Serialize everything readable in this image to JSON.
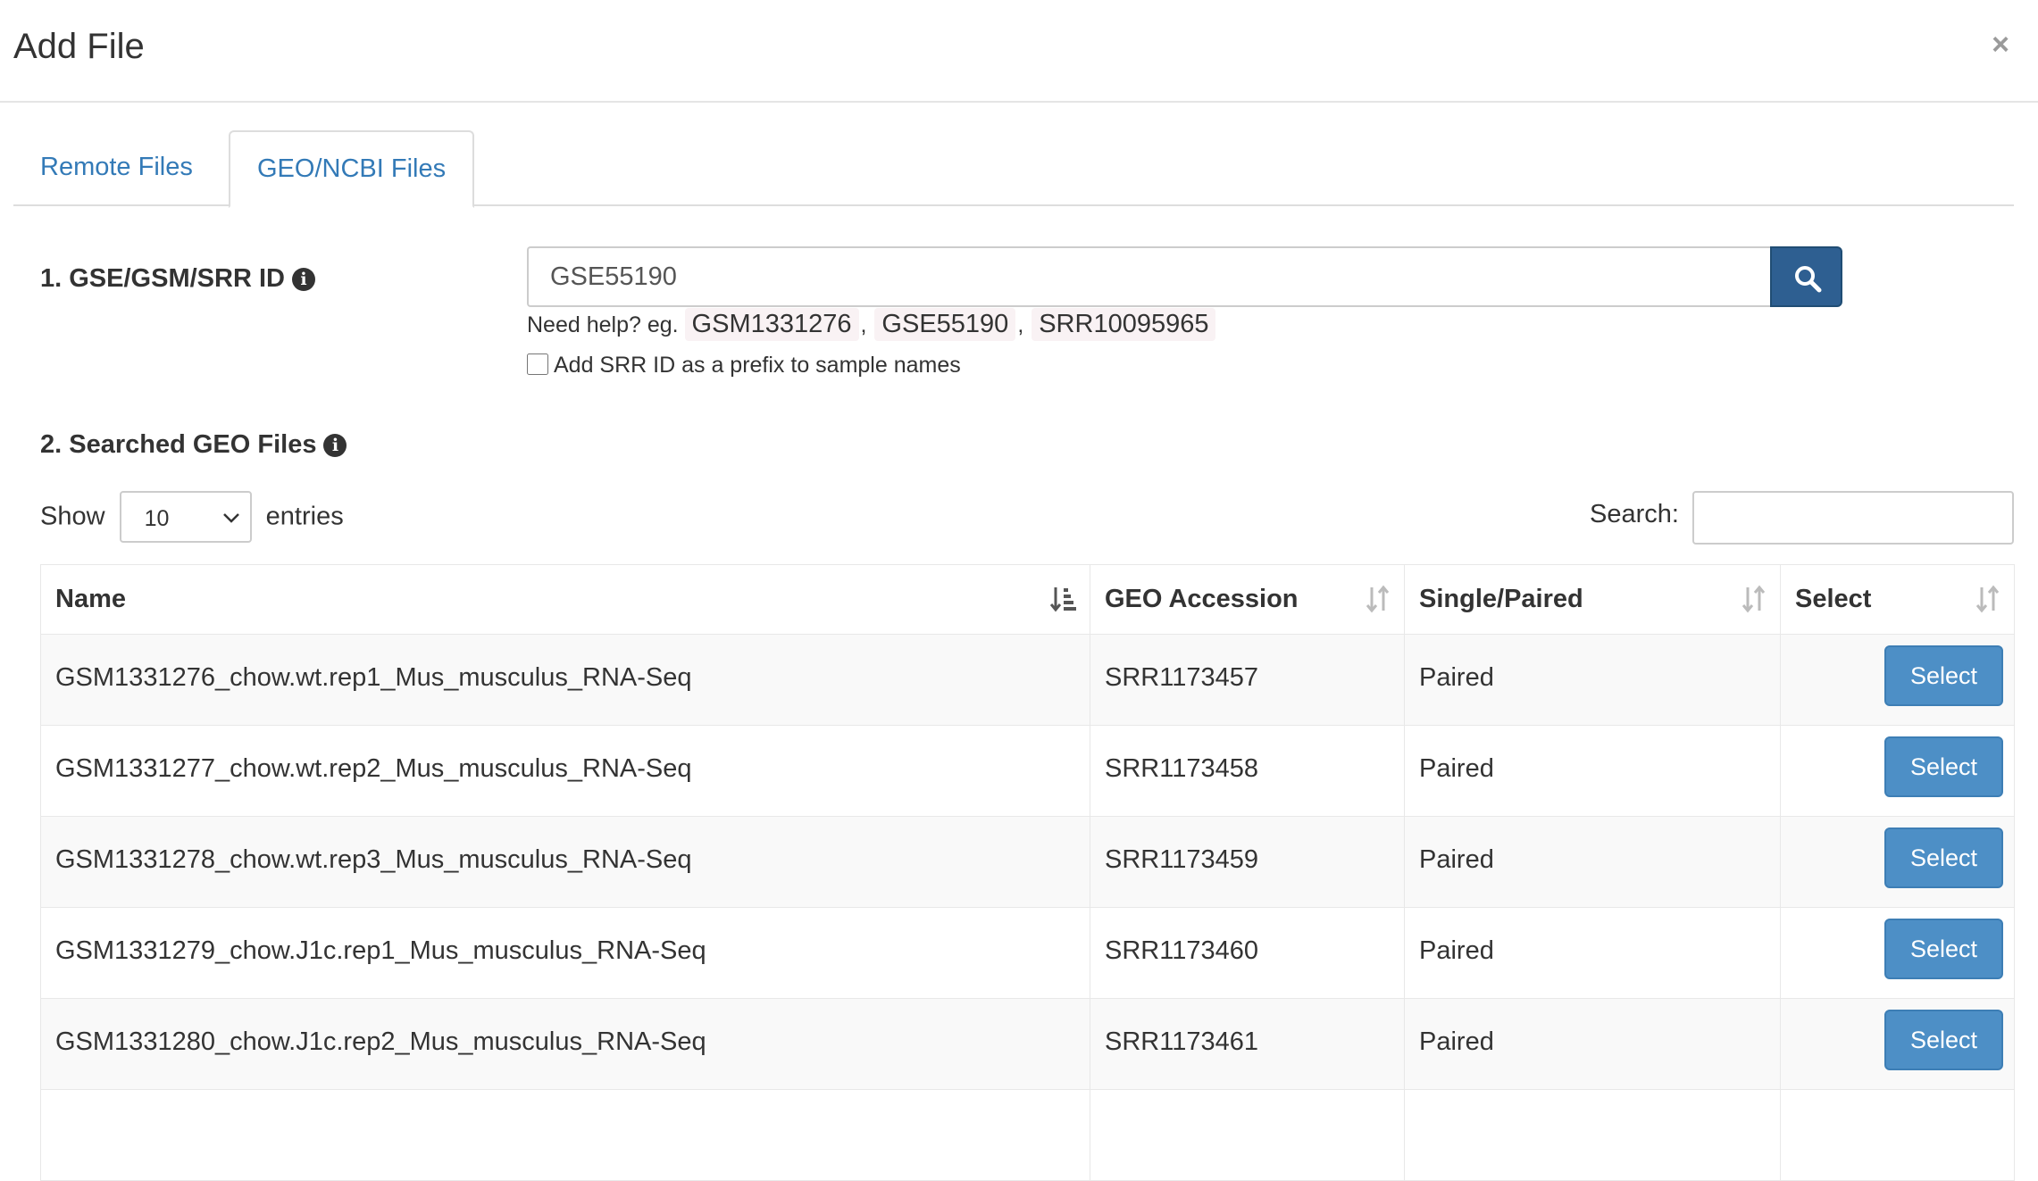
{
  "modal": {
    "title": "Add File",
    "close_glyph": "×"
  },
  "tabs": [
    {
      "label": "Remote Files",
      "active": false
    },
    {
      "label": "GEO/NCBI Files",
      "active": true
    }
  ],
  "step1": {
    "label": "1. GSE/GSM/SRR ID",
    "input_value": "GSE55190",
    "help_prefix": "Need help? eg.",
    "examples": [
      "GSM1331276",
      "GSE55190",
      "SRR10095965"
    ],
    "separator": ",",
    "checkbox_label": "Add SRR ID as a prefix to sample names",
    "checkbox_checked": false
  },
  "step2": {
    "label": "2. Searched GEO Files",
    "show_label": "Show",
    "entries_value": "10",
    "entries_label": "entries",
    "search_label": "Search:"
  },
  "table": {
    "headers": [
      "Name",
      "GEO Accession",
      "Single/Paired",
      "Select"
    ],
    "select_button_label": "Select",
    "rows": [
      {
        "name": "GSM1331276_chow.wt.rep1_Mus_musculus_RNA-Seq",
        "accession": "SRR1173457",
        "type": "Paired"
      },
      {
        "name": "GSM1331277_chow.wt.rep2_Mus_musculus_RNA-Seq",
        "accession": "SRR1173458",
        "type": "Paired"
      },
      {
        "name": "GSM1331278_chow.wt.rep3_Mus_musculus_RNA-Seq",
        "accession": "SRR1173459",
        "type": "Paired"
      },
      {
        "name": "GSM1331279_chow.J1c.rep1_Mus_musculus_RNA-Seq",
        "accession": "SRR1173460",
        "type": "Paired"
      },
      {
        "name": "GSM1331280_chow.J1c.rep2_Mus_musculus_RNA-Seq",
        "accession": "SRR1173461",
        "type": "Paired"
      }
    ]
  },
  "colors": {
    "link": "#337ab7",
    "primary_dark": "#2e5f91",
    "button": "#4d8fc6"
  },
  "icons": {
    "search": "search-icon",
    "info": "info-icon",
    "close": "close-icon",
    "sort": "sort-icon"
  }
}
